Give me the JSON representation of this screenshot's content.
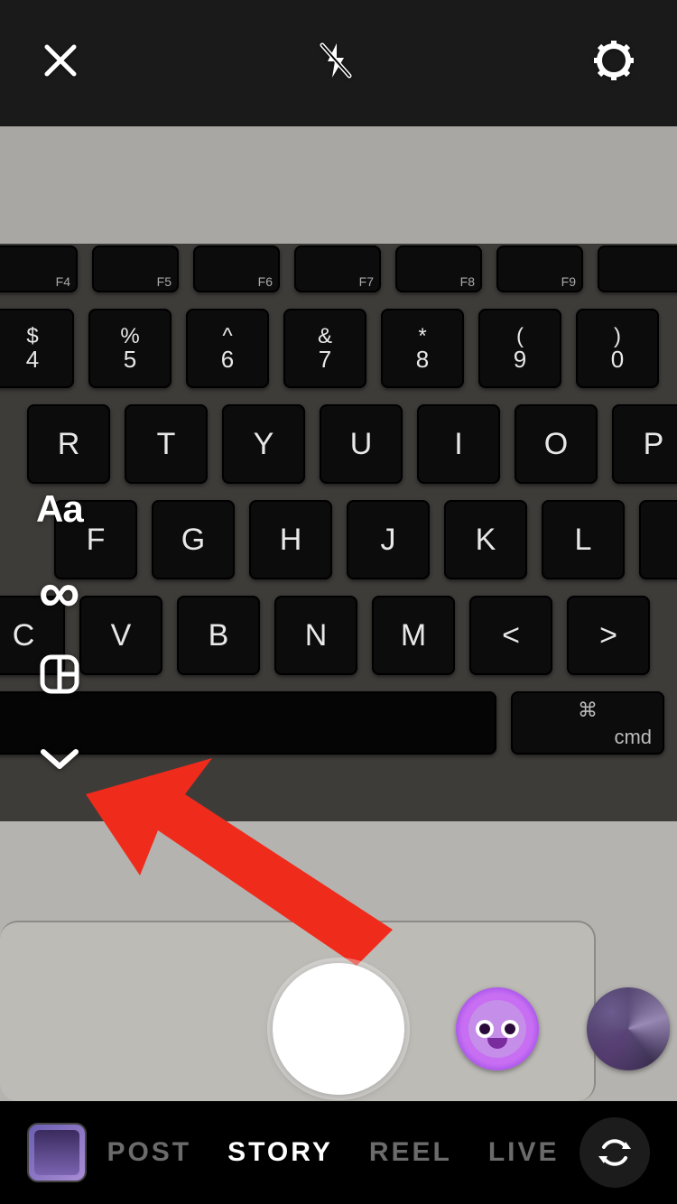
{
  "topbar": {
    "close_icon": "close-icon",
    "flash_icon": "flash-off-icon",
    "settings_icon": "settings-icon"
  },
  "side_tools": {
    "text_label": "Aa",
    "boomerang_label": "∞",
    "layout_icon": "layout-icon",
    "expand_icon": "chevron-down-icon"
  },
  "modes": {
    "items": [
      {
        "label": "POST",
        "active": false
      },
      {
        "label": "STORY",
        "active": true
      },
      {
        "label": "REEL",
        "active": false
      },
      {
        "label": "LIVE",
        "active": false
      }
    ]
  },
  "keyboard": {
    "fn_row": [
      "F4",
      "F5",
      "F6",
      "F7",
      "F8",
      "F9",
      ""
    ],
    "num_row": [
      {
        "sym": "$",
        "num": "4"
      },
      {
        "sym": "%",
        "num": "5"
      },
      {
        "sym": "^",
        "num": "6"
      },
      {
        "sym": "&",
        "num": "7"
      },
      {
        "sym": "*",
        "num": "8"
      },
      {
        "sym": "(",
        "num": "9"
      },
      {
        "sym": ")",
        "num": "0"
      }
    ],
    "row2": [
      "R",
      "T",
      "Y",
      "U",
      "I",
      "O",
      "P"
    ],
    "row3": [
      "F",
      "G",
      "H",
      "J",
      "K",
      "L",
      ""
    ],
    "row4": [
      "C",
      "V",
      "B",
      "N",
      "M",
      "<",
      ">"
    ],
    "cmd_key": {
      "sym": "⌘",
      "label": "cmd"
    }
  },
  "annotation": {
    "arrow_color": "#ef2b1c"
  }
}
